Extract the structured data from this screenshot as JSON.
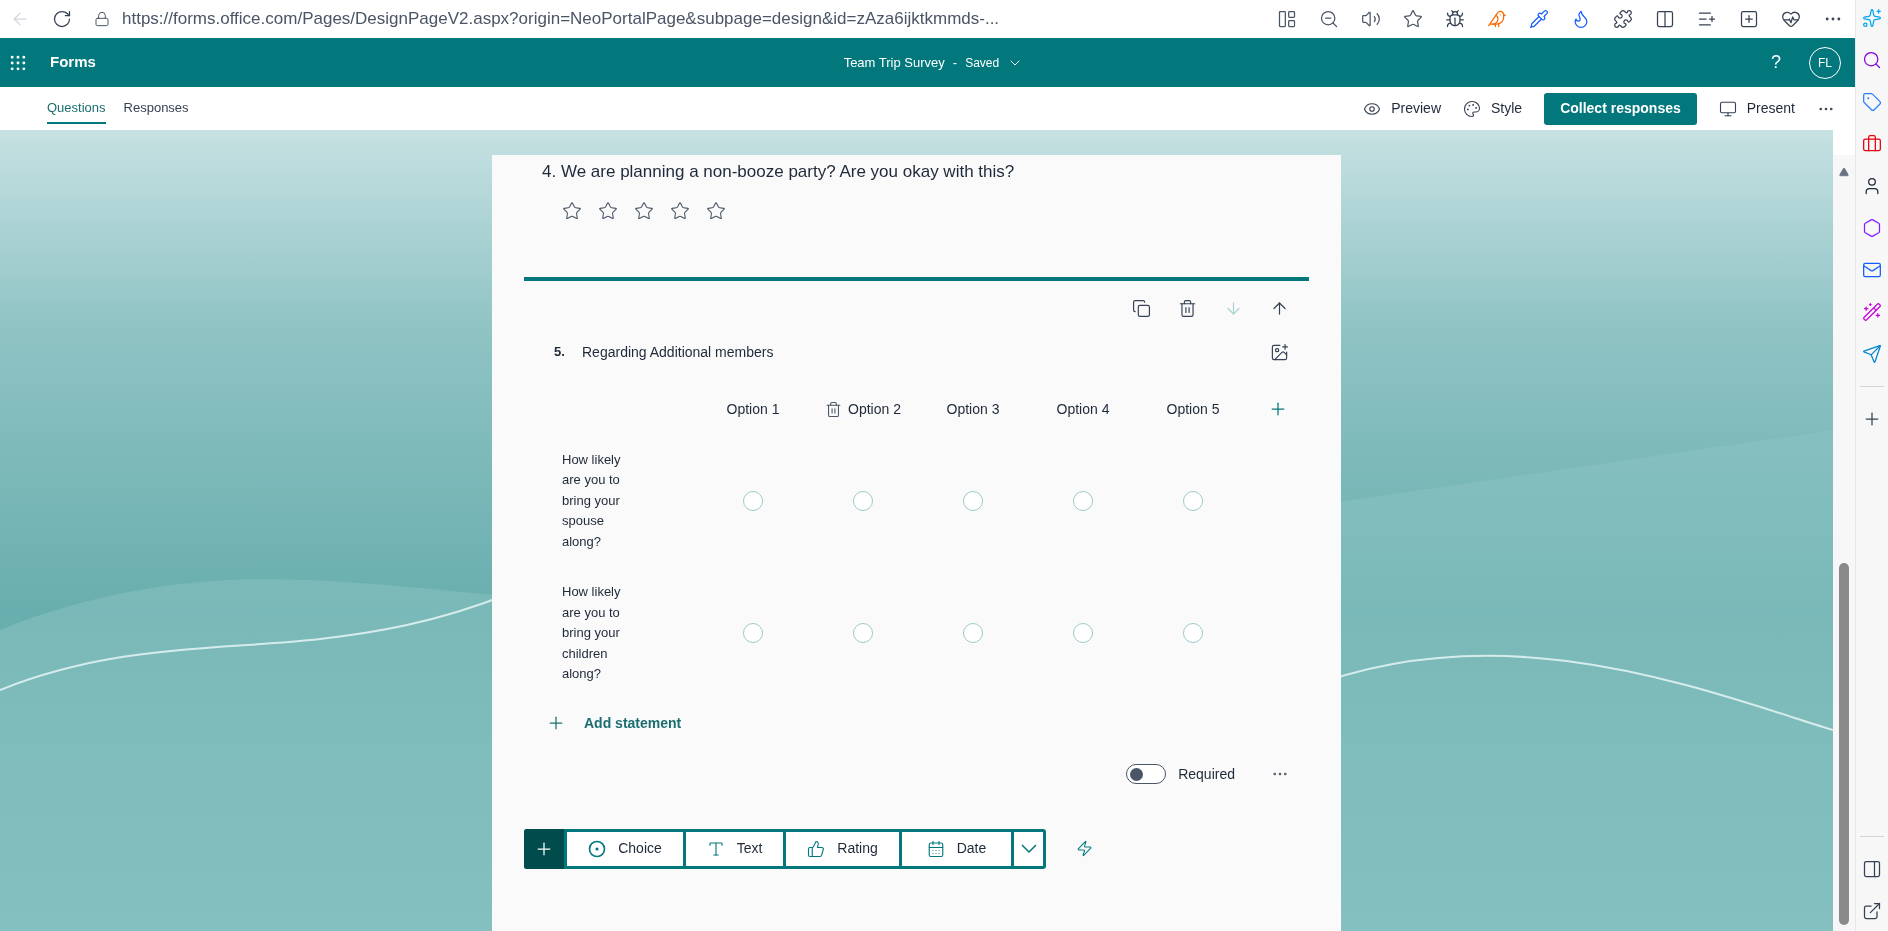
{
  "browser": {
    "url": "https://forms.office.com/Pages/DesignPageV2.aspx?origin=NeoPortalPage&subpage=design&id=zAza6ijktkmmds-..."
  },
  "app_bar": {
    "app_name": "Forms",
    "form_title": "Team Trip Survey",
    "separator": "-",
    "save_status": "Saved",
    "help": "?",
    "avatar": "FL"
  },
  "tabs": [
    {
      "label": "Questions",
      "selected": true
    },
    {
      "label": "Responses",
      "selected": false
    }
  ],
  "actions": [
    {
      "label": "Preview",
      "kind": "preview"
    },
    {
      "label": "Style",
      "kind": "style"
    },
    {
      "label": "Collect responses",
      "kind": "primary"
    },
    {
      "label": "Present",
      "kind": "present"
    }
  ],
  "questions": [
    {
      "kind": "rating",
      "number": "4.",
      "title": "We are planning a non-booze party? Are you okay with this?",
      "stars": 0
    },
    {
      "kind": "likert",
      "number": "5.",
      "title": "Regarding Additional members",
      "active": true,
      "options": [
        {
          "label": "Option 1",
          "hovered": false
        },
        {
          "label": "Option 2",
          "hovered": true
        },
        {
          "label": "Option 3",
          "hovered": false
        },
        {
          "label": "Option 4",
          "hovered": false
        },
        {
          "label": "Option 5",
          "hovered": false
        }
      ],
      "statements": [
        {
          "text": "How likely are you to bring your spouse along?"
        },
        {
          "text": "How likely are you to bring your children along?"
        }
      ],
      "add_statement": "Add statement",
      "required": {
        "label": "Required",
        "on": false
      }
    }
  ],
  "insert_toolbar": {
    "items": [
      {
        "label": "Choice",
        "kind": "choice"
      },
      {
        "label": "Text",
        "kind": "text"
      },
      {
        "label": "Rating",
        "kind": "rating"
      },
      {
        "label": "Date",
        "kind": "date"
      }
    ]
  }
}
